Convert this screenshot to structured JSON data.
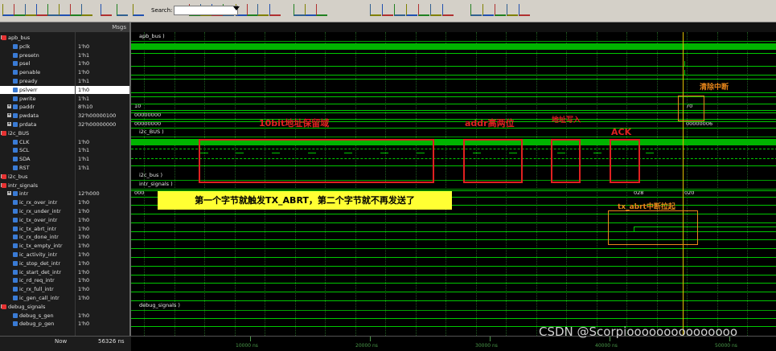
{
  "toolbar": {
    "search_label": "Search:",
    "search_value": "",
    "icons": [
      "step-icon",
      "step-over-icon",
      "step-back-icon",
      "run-icon",
      "continue-icon",
      "break-icon",
      "restart-icon",
      "insert-icon",
      "expand-icon",
      "collapse-icon",
      "find-icon",
      "zoom-in-icon",
      "zoom-out-icon",
      "zoom-fit-icon",
      "zoom-cursor-icon",
      "zoom-full-icon",
      "cursor-add-icon",
      "cursor-del-icon",
      "wave-style-icon",
      "lock-icon",
      "grid-icon",
      "format-icon"
    ]
  },
  "panel": {
    "msgs_label": "Msgs"
  },
  "signals": [
    {
      "name": "apb_bus",
      "value": "",
      "type": "group",
      "expand": "−",
      "indent": 8
    },
    {
      "name": "pclk",
      "value": "1'h0",
      "type": "sig",
      "indent": 22
    },
    {
      "name": "presetn",
      "value": "1'h1",
      "type": "sig",
      "indent": 22
    },
    {
      "name": "psel",
      "value": "1'h0",
      "type": "sig",
      "indent": 22
    },
    {
      "name": "penable",
      "value": "1'h0",
      "type": "sig",
      "indent": 22
    },
    {
      "name": "pready",
      "value": "1'h1",
      "type": "sig",
      "indent": 22
    },
    {
      "name": "pslverr",
      "value": "1'h0",
      "type": "sig",
      "indent": 22,
      "selected": true
    },
    {
      "name": "pwrite",
      "value": "1'h1",
      "type": "sig",
      "indent": 22
    },
    {
      "name": "paddr",
      "value": "8'h10",
      "type": "bus",
      "expand": "+",
      "indent": 22
    },
    {
      "name": "pwdata",
      "value": "32'h00000100",
      "type": "bus",
      "expand": "+",
      "indent": 22
    },
    {
      "name": "prdata",
      "value": "32'h00000000",
      "type": "bus",
      "expand": "+",
      "indent": 22
    },
    {
      "name": "i2c_BUS",
      "value": "",
      "type": "group",
      "expand": "−",
      "indent": 8
    },
    {
      "name": "CLK",
      "value": "1'h0",
      "type": "sig",
      "indent": 22
    },
    {
      "name": "SCL",
      "value": "1'h1",
      "type": "sig",
      "indent": 22
    },
    {
      "name": "SDA",
      "value": "1'h1",
      "type": "sig",
      "indent": 22
    },
    {
      "name": "RST",
      "value": "1'h1",
      "type": "sig",
      "indent": 22
    },
    {
      "name": "i2c_bus",
      "value": "",
      "type": "group",
      "expand": "+",
      "indent": 8
    },
    {
      "name": "intr_signals",
      "value": "",
      "type": "group",
      "expand": "−",
      "indent": 8
    },
    {
      "name": "intr",
      "value": "12'h000",
      "type": "bus",
      "expand": "+",
      "indent": 22
    },
    {
      "name": "ic_rx_over_intr",
      "value": "1'h0",
      "type": "sig",
      "indent": 22
    },
    {
      "name": "ic_rx_under_intr",
      "value": "1'h0",
      "type": "sig",
      "indent": 22
    },
    {
      "name": "ic_tx_over_intr",
      "value": "1'h0",
      "type": "sig",
      "indent": 22
    },
    {
      "name": "ic_tx_abrt_intr",
      "value": "1'h0",
      "type": "sig",
      "indent": 22
    },
    {
      "name": "ic_rx_done_intr",
      "value": "1'h0",
      "type": "sig",
      "indent": 22
    },
    {
      "name": "ic_tx_empty_intr",
      "value": "1'h0",
      "type": "sig",
      "indent": 22
    },
    {
      "name": "ic_activity_intr",
      "value": "1'h0",
      "type": "sig",
      "indent": 22
    },
    {
      "name": "ic_stop_det_intr",
      "value": "1'h0",
      "type": "sig",
      "indent": 22
    },
    {
      "name": "ic_start_det_intr",
      "value": "1'h0",
      "type": "sig",
      "indent": 22
    },
    {
      "name": "ic_rd_req_intr",
      "value": "1'h0",
      "type": "sig",
      "indent": 22
    },
    {
      "name": "ic_rx_full_intr",
      "value": "1'h0",
      "type": "sig",
      "indent": 22
    },
    {
      "name": "ic_gen_call_intr",
      "value": "1'h0",
      "type": "sig",
      "indent": 22
    },
    {
      "name": "debug_signals",
      "value": "",
      "type": "group",
      "expand": "−",
      "indent": 8
    },
    {
      "name": "debug_s_gen",
      "value": "1'h0",
      "type": "sig",
      "indent": 22
    },
    {
      "name": "debug_p_gen",
      "value": "1'h0",
      "type": "sig",
      "indent": 22
    }
  ],
  "wave_labels": {
    "apb_bus": "apb_bus )",
    "paddr_a": "10",
    "paddr_b": "70",
    "pwdata": "00000000",
    "prdata_a": "00000000",
    "prdata_b": "00000006",
    "i2c_BUS": "i2c_BUS )",
    "i2c_bus": "i2c_bus )",
    "intr_signals": "intr_signals )",
    "intr_a": "000",
    "intr_b": "028",
    "intr_c": "020",
    "debug_signals": "debug_signals )"
  },
  "annotations": {
    "reserved": "10bit地址保留域",
    "addr_high": "addr高两位",
    "addr_write": "地址写入",
    "ack": "ACK",
    "clear_intr": "清除中断",
    "abrt_up": "tx_abrt中断拉起",
    "summary": "第一个字节就触发TX_ABRT，第二个字节就不再发送了"
  },
  "status": {
    "now_label": "Now",
    "now_value": "56326 ns",
    "ticks": [
      "10000 ns",
      "20000 ns",
      "30000 ns",
      "40000 ns",
      "50000 ns"
    ]
  },
  "watermark": "CSDN @Scorpiooooooooooooooo",
  "colors": {
    "wave": "#00c800",
    "annot_red": "#e02020",
    "annot_orange": "#e8861a",
    "highlight": "#ffff33"
  }
}
